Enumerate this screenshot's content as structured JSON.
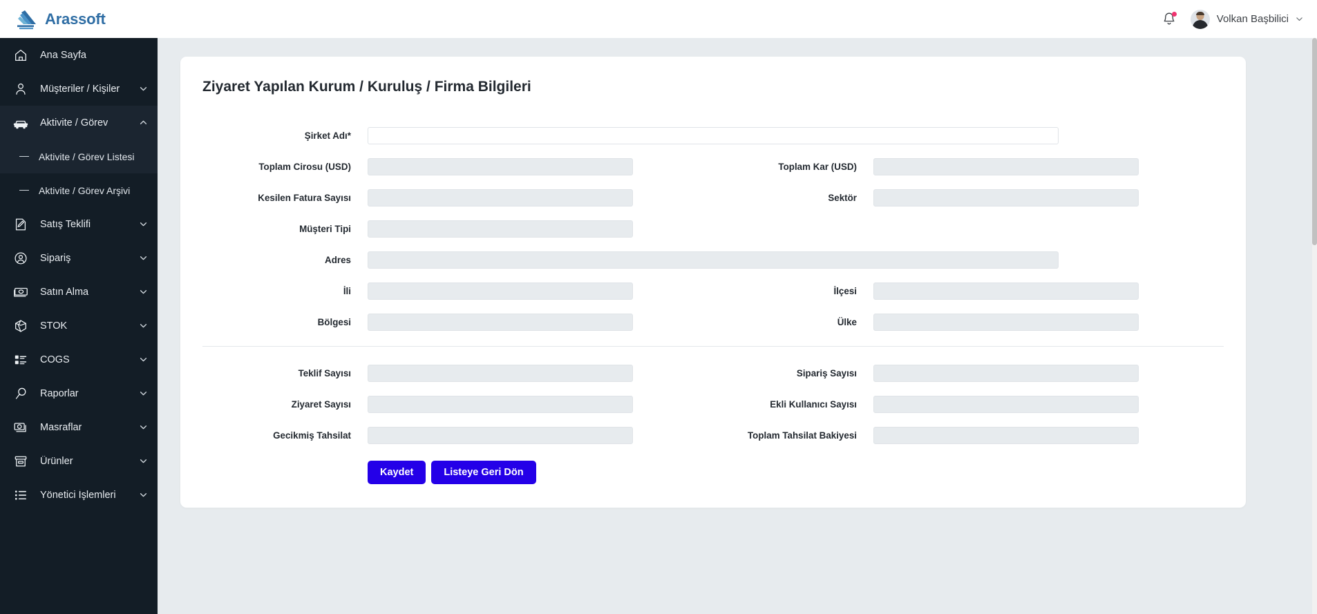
{
  "brand": {
    "name": "Arassoft",
    "icon": "arassoft-logo"
  },
  "header": {
    "notifications_icon": "bell-icon",
    "user_name": "Volkan Başbilici",
    "user_chevron_icon": "chevron-down-icon",
    "avatar_icon": "user-avatar"
  },
  "sidebar": {
    "items": [
      {
        "label": "Ana Sayfa",
        "icon": "home-icon",
        "expandable": false,
        "active": false,
        "sub": false
      },
      {
        "label": "Müşteriler / Kişiler",
        "icon": "user-icon",
        "expandable": true,
        "active": false,
        "sub": false
      },
      {
        "label": "Aktivite / Görev",
        "icon": "car-icon",
        "expandable": true,
        "expanded": true,
        "active": true,
        "sub": false
      },
      {
        "label": "Aktivite / Görev Listesi",
        "icon": "dash-icon",
        "expandable": false,
        "active": true,
        "sub": true
      },
      {
        "label": "Aktivite / Görev Arşivi",
        "icon": "dash-icon",
        "expandable": false,
        "active": false,
        "sub": true
      },
      {
        "label": "Satış Teklifi",
        "icon": "edit-document-icon",
        "expandable": true,
        "active": false,
        "sub": false
      },
      {
        "label": "Sipariş",
        "icon": "user-circle-icon",
        "expandable": true,
        "active": false,
        "sub": false
      },
      {
        "label": "Satın Alma",
        "icon": "money-icon",
        "expandable": true,
        "active": false,
        "sub": false
      },
      {
        "label": "STOK",
        "icon": "cube-icon",
        "expandable": true,
        "active": false,
        "sub": false
      },
      {
        "label": "COGS",
        "icon": "list-ab-icon",
        "expandable": true,
        "active": false,
        "sub": false
      },
      {
        "label": "Raporlar",
        "icon": "search-icon",
        "expandable": true,
        "active": false,
        "sub": false
      },
      {
        "label": "Masraflar",
        "icon": "cash-icon",
        "expandable": true,
        "active": false,
        "sub": false
      },
      {
        "label": "Ürünler",
        "icon": "archive-box-icon",
        "expandable": true,
        "active": false,
        "sub": false
      },
      {
        "label": "Yönetici İşlemleri",
        "icon": "bullet-list-icon",
        "expandable": true,
        "active": false,
        "sub": false
      }
    ]
  },
  "main": {
    "card_title": "Ziyaret Yapılan Kurum / Kuruluş / Firma Bilgileri",
    "fields": {
      "sirket_adi": {
        "label": "Şirket Adı*",
        "value": "",
        "placeholder": ""
      },
      "toplam_cirosu": {
        "label": "Toplam Cirosu (USD)",
        "value": "",
        "placeholder": ""
      },
      "toplam_kar": {
        "label": "Toplam Kar (USD)",
        "value": "",
        "placeholder": ""
      },
      "kesilen_fatura_sayisi": {
        "label": "Kesilen Fatura Sayısı",
        "value": "",
        "placeholder": ""
      },
      "sektor": {
        "label": "Sektör",
        "value": "",
        "placeholder": ""
      },
      "musteri_tipi": {
        "label": "Müşteri Tipi",
        "value": "",
        "placeholder": ""
      },
      "adres": {
        "label": "Adres",
        "value": "",
        "placeholder": ""
      },
      "ili": {
        "label": "İli",
        "value": "",
        "placeholder": ""
      },
      "ilcesi": {
        "label": "İlçesi",
        "value": "",
        "placeholder": ""
      },
      "bolgesi": {
        "label": "Bölgesi",
        "value": "",
        "placeholder": ""
      },
      "ulke": {
        "label": "Ülke",
        "value": "",
        "placeholder": ""
      },
      "teklif_sayisi": {
        "label": "Teklif Sayısı",
        "value": "",
        "placeholder": ""
      },
      "siparis_sayisi": {
        "label": "Sipariş Sayısı",
        "value": "",
        "placeholder": ""
      },
      "ziyaret_sayisi": {
        "label": "Ziyaret Sayısı",
        "value": "",
        "placeholder": ""
      },
      "ekli_kullanici_sayisi": {
        "label": "Ekli Kullanıcı Sayısı",
        "value": "",
        "placeholder": ""
      },
      "gecikmis_tahsilat": {
        "label": "Gecikmiş Tahsilat",
        "value": "",
        "placeholder": ""
      },
      "toplam_tahsilat_bakiyesi": {
        "label": "Toplam Tahsilat Bakiyesi",
        "value": "",
        "placeholder": ""
      }
    },
    "buttons": {
      "save": "Kaydet",
      "back_to_list": "Listeye Geri Dön"
    }
  },
  "colors": {
    "brand_blue": "#2e6da4",
    "sidebar_bg": "#131d26",
    "sidebar_active": "#1b2530",
    "button_blue": "#2400e8",
    "page_bg": "#e7ebee",
    "field_disabled_bg": "#e7ebee",
    "notification_dot": "#f0336f"
  }
}
